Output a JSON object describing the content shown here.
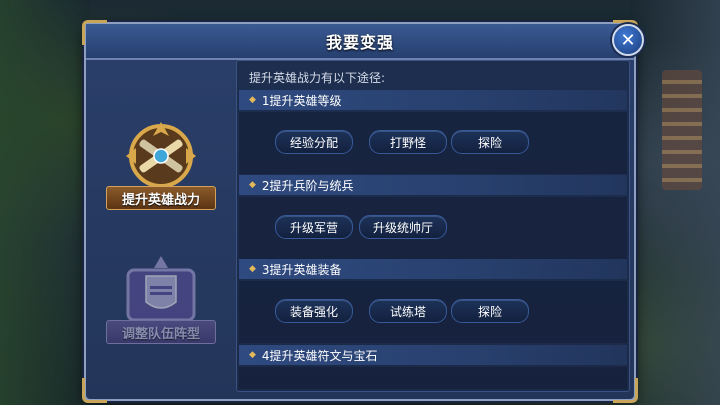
{
  "dialog": {
    "title": "我要变强"
  },
  "badges": [
    {
      "label": "提升英雄战力",
      "active": true
    },
    {
      "label": "调整队伍阵型",
      "active": false
    }
  ],
  "intro": "提升英雄战力有以下途径:",
  "sections": [
    {
      "title": "1提升英雄等级",
      "buttons": [
        "经验分配",
        "打野怪",
        "探险"
      ]
    },
    {
      "title": "2提升兵阶与统兵",
      "buttons": [
        "升级军营",
        "升级统帅厅"
      ]
    },
    {
      "title": "3提升英雄装备",
      "buttons": [
        "装备强化",
        "试练塔",
        "探险"
      ]
    },
    {
      "title": "4提升英雄符文与宝石",
      "buttons": []
    }
  ],
  "close": {
    "glyph": "✕"
  },
  "colors": {
    "accent_gold": "#c9a55a",
    "panel_blue": "#233559"
  }
}
